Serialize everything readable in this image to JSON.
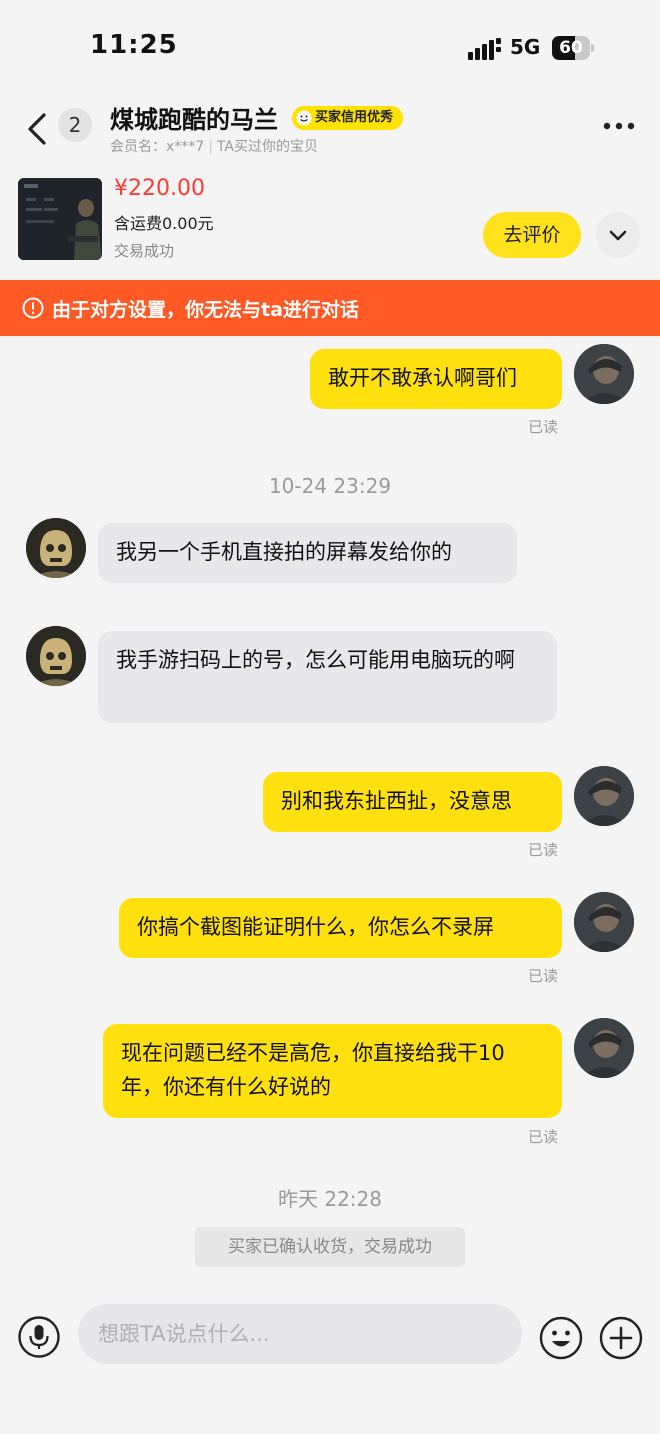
{
  "status_bar": {
    "time": "11:25",
    "network": "5G",
    "battery": "60",
    "battery_level": 0.6
  },
  "header": {
    "unread_count": "2",
    "contact_name": "煤城跑酷的马兰",
    "credit_badge": "买家信用优秀",
    "member_label": "会员名：",
    "member_id": "x***7",
    "member_note": "TA买过你的宝贝"
  },
  "product": {
    "price": "¥220.00",
    "shipping": "含运费0.00元",
    "status": "交易成功",
    "review_button": "去评价"
  },
  "notice": {
    "text": "由于对方设置，你无法与ta进行对话"
  },
  "messages": [
    {
      "text": "敢开不敢承认啊哥们",
      "read": "已读"
    },
    {
      "timestamp": "10-24 23:29"
    },
    {
      "text": "我另一个手机直接拍的屏幕发给你的"
    },
    {
      "text": "我手游扫码上的号，怎么可能用电脑玩的啊"
    },
    {
      "text": "别和我东扯西扯，没意思",
      "read": "已读"
    },
    {
      "text": "你搞个截图能证明什么，你怎么不录屏",
      "read": "已读"
    },
    {
      "text": "现在问题已经不是高危，你直接给我干10年，你还有什么好说的",
      "read": "已读"
    },
    {
      "timestamp": "昨天 22:28"
    },
    {
      "system": "买家已确认收货，交易成功"
    }
  ],
  "input": {
    "placeholder": "想跟TA说点什么..."
  },
  "colors": {
    "accent_yellow": "#ffe00f",
    "notice_orange": "#ff5a26",
    "price_red": "#ff3b30"
  }
}
